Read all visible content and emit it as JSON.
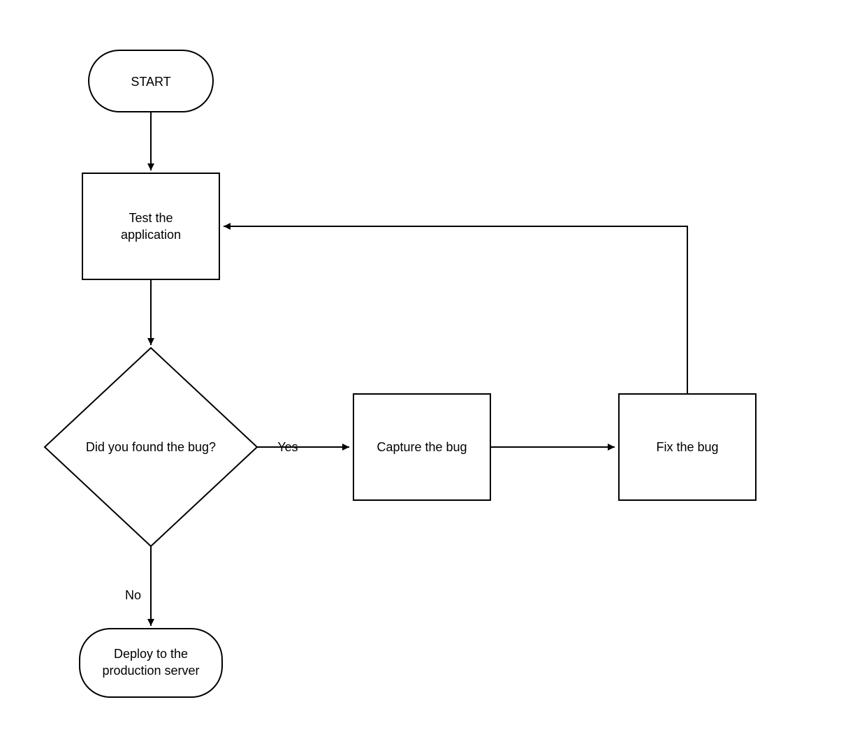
{
  "chart_data": {
    "type": "flowchart",
    "nodes": [
      {
        "id": "start",
        "shape": "terminator",
        "label": "START"
      },
      {
        "id": "test",
        "shape": "process",
        "label": "Test the application"
      },
      {
        "id": "decide",
        "shape": "decision",
        "label": "Did you found the bug?"
      },
      {
        "id": "capture",
        "shape": "process",
        "label": "Capture the bug"
      },
      {
        "id": "fix",
        "shape": "process",
        "label": "Fix the bug"
      },
      {
        "id": "deploy",
        "shape": "terminator",
        "label": "Deploy to the production server"
      }
    ],
    "edges": [
      {
        "from": "start",
        "to": "test",
        "label": ""
      },
      {
        "from": "test",
        "to": "decide",
        "label": ""
      },
      {
        "from": "decide",
        "to": "capture",
        "label": "Yes"
      },
      {
        "from": "decide",
        "to": "deploy",
        "label": "No"
      },
      {
        "from": "capture",
        "to": "fix",
        "label": ""
      },
      {
        "from": "fix",
        "to": "test",
        "label": ""
      }
    ]
  },
  "nodes": {
    "start_label": "START",
    "test_line1": "Test the",
    "test_line2": "application",
    "decision_label": "Did you found the bug?",
    "capture_label": "Capture the bug",
    "fix_label": "Fix the bug",
    "deploy_line1": "Deploy to the",
    "deploy_line2": "production server"
  },
  "edges": {
    "yes_label": "Yes",
    "no_label": "No"
  }
}
